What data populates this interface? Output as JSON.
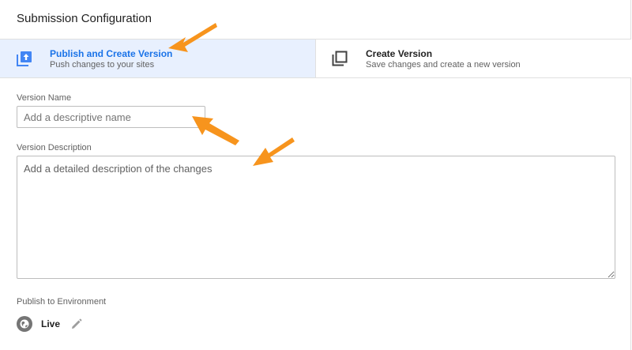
{
  "title": "Submission Configuration",
  "options": [
    {
      "title": "Publish and Create Version",
      "subtitle": "Push changes to your sites",
      "icon": "publish-icon",
      "selected": true
    },
    {
      "title": "Create Version",
      "subtitle": "Save changes and create a new version",
      "icon": "copy-icon",
      "selected": false
    }
  ],
  "version_name": {
    "label": "Version Name",
    "value": "",
    "placeholder": "Add a descriptive name"
  },
  "version_description": {
    "label": "Version Description",
    "value": "",
    "placeholder": "Add a detailed description of the changes"
  },
  "environment": {
    "label": "Publish to Environment",
    "name": "Live",
    "icon": "globe-icon",
    "edit_icon": "pencil-icon"
  },
  "colors": {
    "accent": "#1a73e8",
    "selected_bg": "#e8f0fe",
    "annotation_arrow": "#f7941d"
  }
}
